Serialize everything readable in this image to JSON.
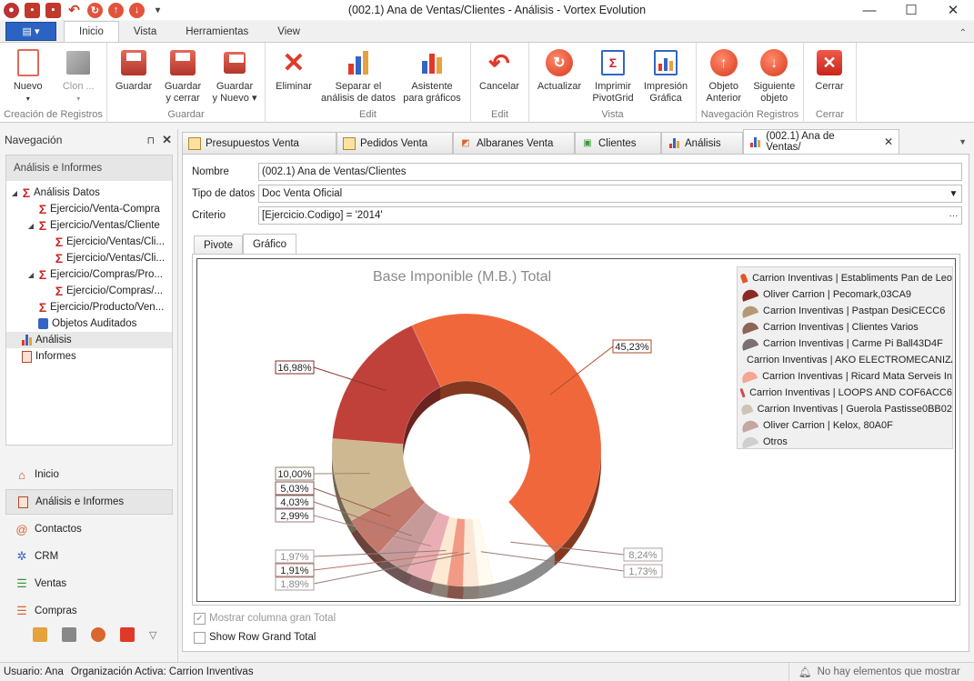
{
  "window": {
    "title": "(002.1) Ana de Ventas/Clientes - Análisis - Vortex Evolution",
    "qat_dropdown": "▾",
    "minimize": "—",
    "maximize": "☐",
    "close": "✕"
  },
  "ribbon_tabs": [
    {
      "label": "Inicio",
      "active": true
    },
    {
      "label": "Vista"
    },
    {
      "label": "Herramientas"
    },
    {
      "label": "View"
    }
  ],
  "ribbon": {
    "groups": {
      "creacion": "Creación de Registros",
      "guardar": "Guardar",
      "edit": "Edit",
      "edit2": "Edit",
      "vista": "Vista",
      "navegacion": "Navegación Registros",
      "cerrar": "Cerrar"
    },
    "buttons": {
      "nuevo": "Nuevo",
      "clon": "Clon ...",
      "guardar": "Guardar",
      "guardar_cerrar_1": "Guardar",
      "guardar_cerrar_2": "y cerrar",
      "guardar_nuevo_1": "Guardar",
      "guardar_nuevo_2": "y Nuevo",
      "eliminar": "Eliminar",
      "separar_1": "Separar el",
      "separar_2": "análisis de datos",
      "asistente_1": "Asistente",
      "asistente_2": "para gráficos",
      "cancelar": "Cancelar",
      "actualizar": "Actualizar",
      "imprimir_1": "Imprimir",
      "imprimir_2": "PivotGrid",
      "impresion_1": "Impresión",
      "impresion_2": "Gráfica",
      "anterior_1": "Objeto",
      "anterior_2": "Anterior",
      "siguiente_1": "Siguiente",
      "siguiente_2": "objeto",
      "cerrar": "Cerrar"
    }
  },
  "navigation": {
    "header": "Navegación",
    "pin": "ꟷ",
    "tree_title": "Análisis e Informes",
    "tree": [
      {
        "label": "Análisis Datos",
        "level": 0,
        "type": "sigma",
        "expanded": true
      },
      {
        "label": "Ejercicio/Venta-Compra",
        "level": 1,
        "type": "sigma"
      },
      {
        "label": "Ejercicio/Ventas/Cliente",
        "level": 1,
        "type": "sigma",
        "expanded": true
      },
      {
        "label": "Ejercicio/Ventas/Cli...",
        "level": 2,
        "type": "sigma"
      },
      {
        "label": "Ejercicio/Ventas/Cli...",
        "level": 2,
        "type": "sigma"
      },
      {
        "label": "Ejercicio/Compras/Pro...",
        "level": 1,
        "type": "sigma",
        "expanded": true
      },
      {
        "label": "Ejercicio/Compras/...",
        "level": 2,
        "type": "sigma"
      },
      {
        "label": "Ejercicio/Producto/Ven...",
        "level": 1,
        "type": "sigma"
      },
      {
        "label": "Objetos Auditados",
        "level": 1,
        "type": "audit"
      },
      {
        "label": "Análisis",
        "level": 0,
        "type": "chart",
        "selected": true
      },
      {
        "label": "Informes",
        "level": 0,
        "type": "report"
      }
    ],
    "bottom": [
      {
        "label": "Inicio"
      },
      {
        "label": "Análisis e Informes",
        "active": true
      },
      {
        "label": "Contactos"
      },
      {
        "label": "CRM"
      },
      {
        "label": "Ventas"
      },
      {
        "label": "Compras"
      }
    ]
  },
  "doc_tabs": [
    {
      "label": "Presupuestos Venta"
    },
    {
      "label": "Pedidos Venta"
    },
    {
      "label": "Albaranes Venta"
    },
    {
      "label": "Clientes"
    },
    {
      "label": "Análisis"
    },
    {
      "label": "(002.1) Ana de Ventas/",
      "active": true
    }
  ],
  "form": {
    "nombre_label": "Nombre",
    "nombre_value": "(002.1) Ana de Ventas/Clientes",
    "tipo_label": "Tipo de datos",
    "tipo_value": "Doc Venta Oficial",
    "criterio_label": "Criterio",
    "criterio_value": "[Ejercicio.Codigo]  = '2014'",
    "criterio_btn": "···"
  },
  "subtabs": [
    {
      "label": "Pivote"
    },
    {
      "label": "Gráfico",
      "active": true
    }
  ],
  "chart_data": {
    "type": "pie",
    "title": "Base Imponible (M.B.) Total",
    "legend_position": "top-right",
    "slices": [
      {
        "label": "45,23%",
        "value": 45.23,
        "color": "#f0673c"
      },
      {
        "label": "8,24%",
        "value": 8.24,
        "color": "#ffffff"
      },
      {
        "label": "1,73%",
        "value": 1.73,
        "color": "#fffbee"
      },
      {
        "label": "1,89%",
        "value": 1.89,
        "color": "#fbe7d6"
      },
      {
        "label": "1,91%",
        "value": 1.91,
        "color": "#f29a84"
      },
      {
        "label": "1,97%",
        "value": 1.97,
        "color": "#fde8d2"
      },
      {
        "label": "2,99%",
        "value": 2.99,
        "color": "#e8aeb4"
      },
      {
        "label": "4,03%",
        "value": 4.03,
        "color": "#c79a9a"
      },
      {
        "label": "5,03%",
        "value": 5.03,
        "color": "#c2786b"
      },
      {
        "label": "10,00%",
        "value": 10.0,
        "color": "#cdb891"
      },
      {
        "label": "16,98%",
        "value": 16.98,
        "color": "#c0413a"
      }
    ],
    "legend": [
      {
        "label": "Carrion Inventivas | Establiments Pan de Leo",
        "color": "#e0552c"
      },
      {
        "label": "Oliver Carrion | Pecomark,03CA9",
        "color": "#8a2a22"
      },
      {
        "label": "Carrion Inventivas | Pastpan DesiCECC6",
        "color": "#b39a74"
      },
      {
        "label": "Carrion Inventivas | Clientes Varios",
        "color": "#8e6355"
      },
      {
        "label": "Carrion Inventivas | Carme Pi Ball43D4F",
        "color": "#7a6f72"
      },
      {
        "label": "Carrion Inventivas | AKO ELECTROMECANIZA",
        "color": "#7d5a5a"
      },
      {
        "label": "Carrion Inventivas | Ricard Mata Serveis In",
        "color": "#f3a690"
      },
      {
        "label": "Carrion Inventivas | LOOPS AND COF6ACC6",
        "color": "#d24b45"
      },
      {
        "label": "Carrion Inventivas | Guerola Pastisse0BB02",
        "color": "#cfc4b3"
      },
      {
        "label": "Oliver Carrion | Kelox, 80A0F",
        "color": "#c4a79e"
      },
      {
        "label": "Otros",
        "color": "#cfcfcf"
      }
    ]
  },
  "checkboxes": {
    "gran_total": "Mostrar columna gran Total",
    "row_grand_total": "Show Row Grand Total",
    "checkmark": "✓"
  },
  "status": {
    "usuario": "Usuario: Ana",
    "organizacion": "Organización Activa: Carrion Inventivas",
    "notificaciones": "No hay elementos que mostrar"
  }
}
